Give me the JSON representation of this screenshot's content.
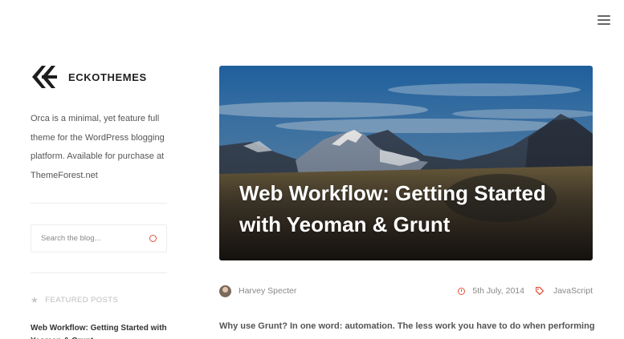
{
  "header": {
    "menu_icon": "hamburger-menu-icon"
  },
  "sidebar": {
    "brand": "ECKOTHEMES",
    "about": "Orca is a minimal, yet feature full theme for the WordPress blogging platform. Available for purchase at ThemeForest.net",
    "search": {
      "placeholder": "Search the blog..."
    },
    "featured_title": "FEATURED POSTS",
    "featured_posts": [
      "Web Workflow: Getting Started with Yeoman & Grunt"
    ]
  },
  "post": {
    "title": "Web Workflow: Getting Started with Yeoman & Grunt",
    "author": "Harvey Specter",
    "date": "5th July, 2014",
    "tag": "JavaScript",
    "excerpt": "Why use Grunt? In one word: automation. The less work you have to do when performing"
  },
  "colors": {
    "accent": "#e4503c",
    "text": "#555555"
  }
}
